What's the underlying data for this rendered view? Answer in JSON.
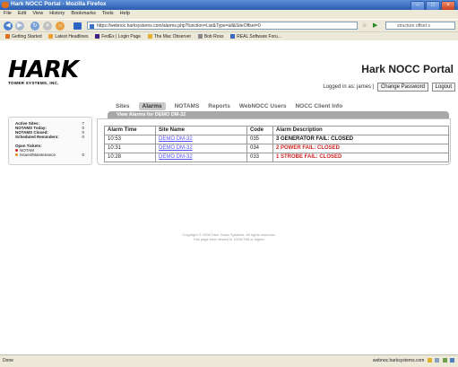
{
  "window": {
    "title": "Hark NOCC Portal - Mozilla Firefox"
  },
  "menu": [
    "File",
    "Edit",
    "View",
    "History",
    "Bookmarks",
    "Tools",
    "Help"
  ],
  "nav": {
    "url": "https://webnoc.harksystems.com/alarms.php?function=List&Type=all&SiteOffset=0",
    "search_placeholder": "structure offset s"
  },
  "bookmarks": [
    "Getting Started",
    "Latest Headlines",
    "FedEx | Login Page",
    "The Mac Observer",
    "Bob Ross",
    "REAL Software Foru..."
  ],
  "header": {
    "logo_text": "HARK",
    "logo_sub": "TOWER SYSTEMS, INC.",
    "portal_title": "Hark NOCC Portal",
    "logged_in": "Logged in as: james |",
    "change_password": "Change Password",
    "logout": "Logout"
  },
  "tabs": [
    "Sites",
    "Alarms",
    "NOTAMS",
    "Reports",
    "WebNOCC Users",
    "NOCC Client Info"
  ],
  "active_tab": "Alarms",
  "panel_title": "View Alarms for DEMO DM-32",
  "sidebar": {
    "stats": [
      {
        "label": "Active Sites:",
        "count": "7"
      },
      {
        "label": "NOTAMS Today:",
        "count": "0"
      },
      {
        "label": "NOTAMS Closed:",
        "count": "0"
      },
      {
        "label": "Scheduled Reminders:",
        "count": "0"
      }
    ],
    "tickets_heading": "Open Tickets:",
    "tickets": [
      {
        "label": "NOTAM",
        "count": "",
        "color": "#cc2222"
      },
      {
        "label": "Issues/Maintenance",
        "count": "0",
        "color": "#e09020"
      }
    ]
  },
  "table": {
    "headers": [
      "Alarm Time",
      "Site Name",
      "Code",
      "Alarm Description"
    ],
    "rows": [
      {
        "time": "10:53",
        "site": "DEMO DM-32",
        "code": "035",
        "desc": "3 GENERATOR FAIL: CLOSED",
        "color": "#111111"
      },
      {
        "time": "10:31",
        "site": "DEMO DM-32",
        "code": "034",
        "desc": "2 POWER FAIL: CLOSED",
        "color": "#cc2222"
      },
      {
        "time": "10:28",
        "site": "DEMO DM-32",
        "code": "033",
        "desc": "1 STROBE FAIL: CLOSED",
        "color": "#cc2222"
      }
    ]
  },
  "footer": {
    "line1": "Copyright © 2008 Hark Tower Systems. All rights reserved.",
    "line2": "This page best viewed in 1024x768 or higher."
  },
  "status": {
    "left": "Done",
    "right": "webnoc.harksystems.com"
  }
}
